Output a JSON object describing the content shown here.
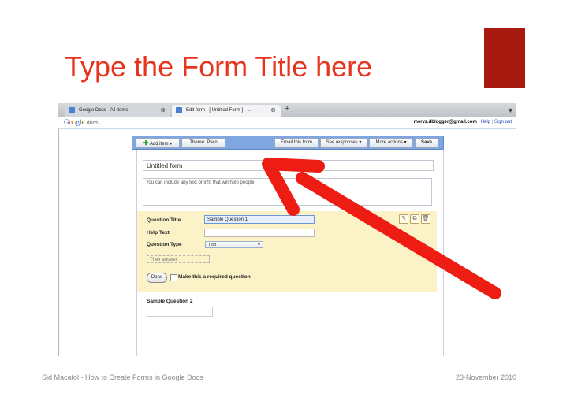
{
  "slide": {
    "title": "Type the Form Title here",
    "footer_left": "Sid Macatol - How to Create Forms in Google Docs",
    "footer_right": "23-November 2010",
    "accent_color": "#e8341c",
    "block_color": "#a8190f"
  },
  "browser": {
    "tabs": [
      {
        "label": "Google Docs - All items",
        "close": "⊗"
      },
      {
        "label": "Edit form - [ Untitled Form ] - ...",
        "close": "⊗"
      }
    ],
    "new_tab": "+",
    "menu_arrow": "▼"
  },
  "gbar": {
    "logo": "Google",
    "logo_suffix": "docs",
    "user_email": "mervz.dblogger@gmail.com",
    "separator": "|",
    "help": "Help",
    "sign_out": "Sign out"
  },
  "toolbar": {
    "add_item": "Add item",
    "theme": "Theme:  Plain",
    "email_form": "Email this form",
    "see_responses": "See responses",
    "more_actions": "More actions",
    "save": "Save",
    "dropdown_caret": "▾"
  },
  "form": {
    "title_value": "Untitled form",
    "description_placeholder": "You can include any text or info that will help people",
    "question_title_label": "Question Title",
    "question_title_value": "Sample Question 1",
    "help_text_label": "Help Text",
    "help_text_value": "",
    "question_type_label": "Question Type",
    "question_type_value": "Text",
    "answer_placeholder": "Their answer",
    "done_label": "Done",
    "required_label": "Make this a required question",
    "question2_title": "Sample Question 2"
  },
  "icons": {
    "edit": "pencil-icon",
    "duplicate": "duplicate-icon",
    "delete": "trash-icon"
  }
}
